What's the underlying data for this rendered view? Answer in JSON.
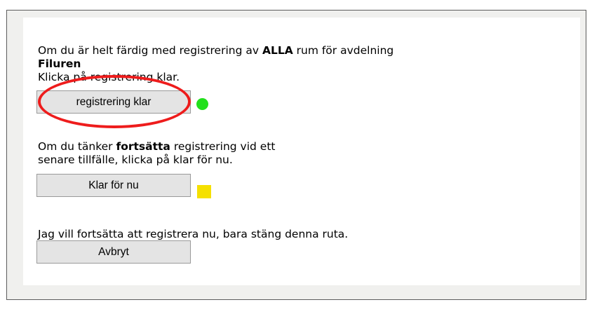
{
  "section_done": {
    "text_before": "Om du är helt färdig med registrering av ",
    "text_bold": "ALLA",
    "text_after": " rum för avdelning",
    "department": "Filuren",
    "instruction": "Klicka på registrering klar.",
    "button_label": "registrering klar",
    "indicator_color": "#22e01c"
  },
  "section_later": {
    "text_before": "Om du tänker ",
    "text_bold": "fortsätta",
    "text_after": " registrering vid ett",
    "line2": "senare tillfälle, klicka på klar för nu.",
    "button_label": "Klar för nu",
    "indicator_color": "#f5e000"
  },
  "section_cancel": {
    "text": "Jag vill fortsätta att registrera nu, bara stäng denna ruta.",
    "button_label": "Avbryt"
  },
  "annotation": {
    "highlight_color": "#ee1c1c"
  }
}
